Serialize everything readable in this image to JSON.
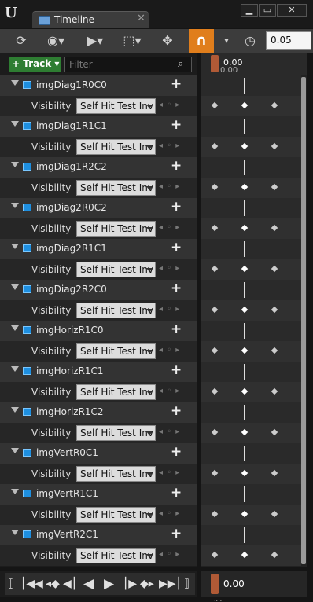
{
  "window": {
    "tab_title": "Timeline",
    "tab_close": "✕",
    "min_label": "▁",
    "max_label": "▭",
    "close_label": "✕"
  },
  "toolbar": {
    "snap_value": "0.05"
  },
  "tracks_header": {
    "add_track_label": "+ Track ▾",
    "filter_placeholder": "Filter"
  },
  "ruler": {
    "time": "0.00",
    "time_sub": "0.00"
  },
  "tracks": [
    {
      "name": "imgDiag1R0C0",
      "property": "Visibility",
      "value": "Self Hit Test Inv"
    },
    {
      "name": "imgDiag1R1C1",
      "property": "Visibility",
      "value": "Self Hit Test Inv"
    },
    {
      "name": "imgDiag1R2C2",
      "property": "Visibility",
      "value": "Self Hit Test Inv"
    },
    {
      "name": "imgDiag2R0C2",
      "property": "Visibility",
      "value": "Self Hit Test Inv"
    },
    {
      "name": "imgDiag2R1C1",
      "property": "Visibility",
      "value": "Self Hit Test Inv"
    },
    {
      "name": "imgDiag2R2C0",
      "property": "Visibility",
      "value": "Self Hit Test Inv"
    },
    {
      "name": "imgHorizR1C0",
      "property": "Visibility",
      "value": "Self Hit Test Inv"
    },
    {
      "name": "imgHorizR1C1",
      "property": "Visibility",
      "value": "Self Hit Test Inv"
    },
    {
      "name": "imgHorizR1C2",
      "property": "Visibility",
      "value": "Self Hit Test Inv"
    },
    {
      "name": "imgVertR0C1",
      "property": "Visibility",
      "value": "Self Hit Test Inv"
    },
    {
      "name": "imgVertR1C1",
      "property": "Visibility",
      "value": "Self Hit Test Inv"
    },
    {
      "name": "imgVertR2C1",
      "property": "Visibility",
      "value": "Self Hit Test Inv"
    }
  ],
  "bottom": {
    "time": "0.00",
    "dots": "...."
  },
  "colors": {
    "snap_accent": "#e07e1c",
    "add_track": "#2e7d32",
    "widget_icon": "#1e8fe0",
    "end_marker": "#9c2a2a"
  }
}
